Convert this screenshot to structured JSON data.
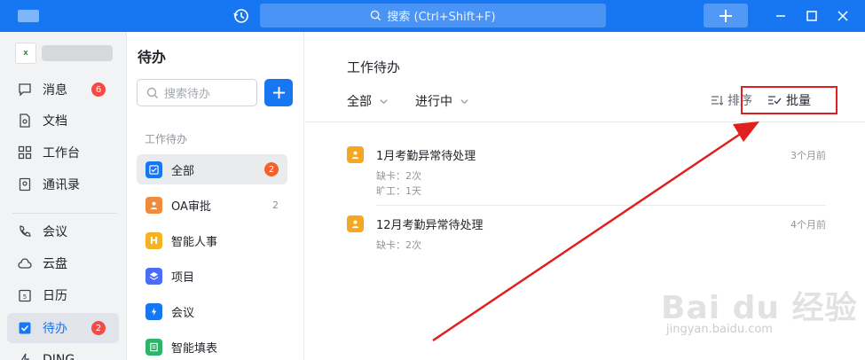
{
  "titlebar": {
    "search_placeholder": "搜索 (Ctrl+Shift+F)",
    "accent": "#1777f3"
  },
  "leftnav": {
    "items": [
      {
        "label": "消息",
        "icon": "chat-icon",
        "badge": "6"
      },
      {
        "label": "文档",
        "icon": "document-icon"
      },
      {
        "label": "工作台",
        "icon": "grid-icon"
      },
      {
        "label": "通讯录",
        "icon": "contacts-icon"
      },
      {
        "label": "会议",
        "icon": "phone-icon"
      },
      {
        "label": "云盘",
        "icon": "cloud-icon"
      },
      {
        "label": "日历",
        "icon": "calendar-icon"
      },
      {
        "label": "待办",
        "icon": "checkbox-icon",
        "badge": "2"
      },
      {
        "label": "DING",
        "icon": "ding-icon"
      }
    ]
  },
  "midcol": {
    "title": "待办",
    "search_placeholder": "搜索待办",
    "section": "工作待办",
    "items": [
      {
        "label": "全部",
        "count": "2",
        "color": "#1777f3",
        "icon": "check-square-icon"
      },
      {
        "label": "OA审批",
        "count": "2",
        "color": "#f08a3c",
        "icon": "person-icon"
      },
      {
        "label": "智能人事",
        "color": "#f5b324",
        "icon": "hr-icon"
      },
      {
        "label": "项目",
        "color": "#4a6cf7",
        "icon": "layers-icon"
      },
      {
        "label": "会议",
        "color": "#1777f3",
        "icon": "lightning-icon"
      },
      {
        "label": "智能填表",
        "color": "#2fb36a",
        "icon": "form-icon"
      }
    ]
  },
  "main": {
    "title": "工作待办",
    "filter_all": "全部",
    "filter_status": "进行中",
    "sort_label": "排序",
    "batch_label": "批量",
    "tasks": [
      {
        "title": "1月考勤异常待处理",
        "time": "3个月前",
        "lines": [
          "缺卡：2次",
          "旷工：1天"
        ]
      },
      {
        "title": "12月考勤异常待处理",
        "time": "4个月前",
        "lines": [
          "缺卡：2次"
        ]
      }
    ]
  },
  "watermark": {
    "text": "Bai du 经验",
    "url": "jingyan.baidu.com"
  }
}
